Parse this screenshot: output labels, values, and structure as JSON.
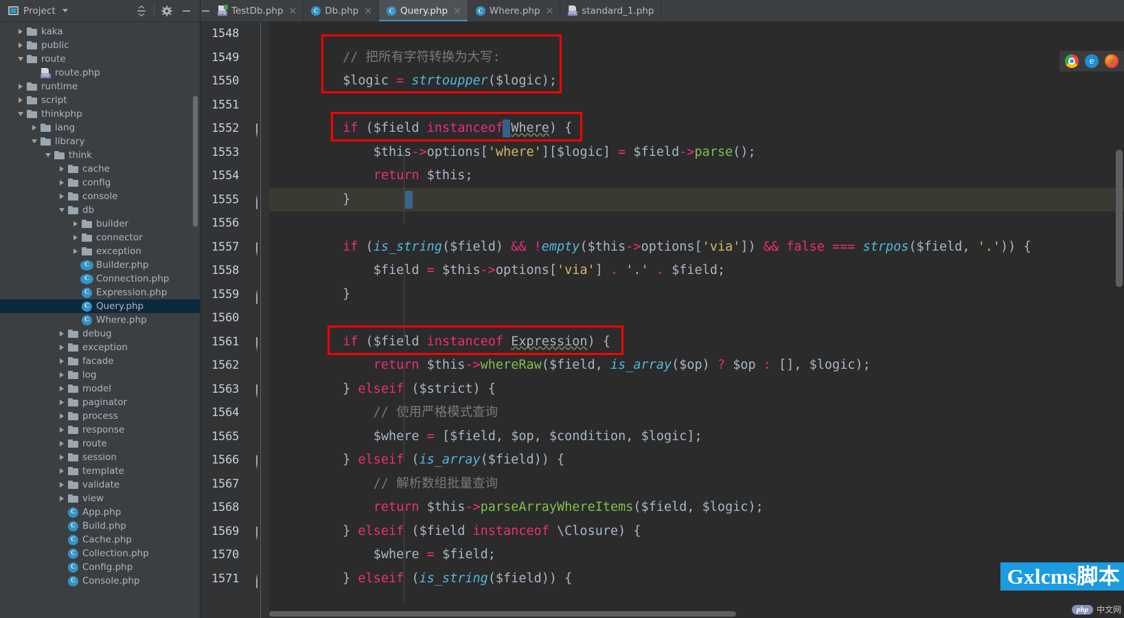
{
  "sidebar": {
    "title": "Project",
    "icons": [
      "project-icon",
      "collapse-all-icon",
      "gear-icon",
      "minimize-icon"
    ],
    "tree": [
      {
        "label": "kaka",
        "depth": 1,
        "type": "folder",
        "state": "collapsed"
      },
      {
        "label": "public",
        "depth": 1,
        "type": "folder",
        "state": "collapsed"
      },
      {
        "label": "route",
        "depth": 1,
        "type": "folder",
        "state": "expanded"
      },
      {
        "label": "route.php",
        "depth": 2,
        "type": "php",
        "state": "none"
      },
      {
        "label": "runtime",
        "depth": 1,
        "type": "folder",
        "state": "collapsed"
      },
      {
        "label": "script",
        "depth": 1,
        "type": "folder",
        "state": "collapsed"
      },
      {
        "label": "thinkphp",
        "depth": 1,
        "type": "folder",
        "state": "expanded"
      },
      {
        "label": "lang",
        "depth": 2,
        "type": "folder",
        "state": "collapsed"
      },
      {
        "label": "library",
        "depth": 2,
        "type": "folder",
        "state": "expanded"
      },
      {
        "label": "think",
        "depth": 3,
        "type": "folder",
        "state": "expanded"
      },
      {
        "label": "cache",
        "depth": 4,
        "type": "folder",
        "state": "collapsed"
      },
      {
        "label": "config",
        "depth": 4,
        "type": "folder",
        "state": "collapsed"
      },
      {
        "label": "console",
        "depth": 4,
        "type": "folder",
        "state": "collapsed"
      },
      {
        "label": "db",
        "depth": 4,
        "type": "folder",
        "state": "expanded"
      },
      {
        "label": "builder",
        "depth": 5,
        "type": "folder",
        "state": "collapsed"
      },
      {
        "label": "connector",
        "depth": 5,
        "type": "folder",
        "state": "collapsed"
      },
      {
        "label": "exception",
        "depth": 5,
        "type": "folder",
        "state": "collapsed"
      },
      {
        "label": "Builder.php",
        "depth": 5,
        "type": "class-abstract",
        "state": "none"
      },
      {
        "label": "Connection.php",
        "depth": 5,
        "type": "class-abstract",
        "state": "none"
      },
      {
        "label": "Expression.php",
        "depth": 5,
        "type": "class",
        "state": "none"
      },
      {
        "label": "Query.php",
        "depth": 5,
        "type": "class",
        "state": "none",
        "selected": true
      },
      {
        "label": "Where.php",
        "depth": 5,
        "type": "class",
        "state": "none"
      },
      {
        "label": "debug",
        "depth": 4,
        "type": "folder",
        "state": "collapsed"
      },
      {
        "label": "exception",
        "depth": 4,
        "type": "folder",
        "state": "collapsed"
      },
      {
        "label": "facade",
        "depth": 4,
        "type": "folder",
        "state": "collapsed"
      },
      {
        "label": "log",
        "depth": 4,
        "type": "folder",
        "state": "collapsed"
      },
      {
        "label": "model",
        "depth": 4,
        "type": "folder",
        "state": "collapsed"
      },
      {
        "label": "paginator",
        "depth": 4,
        "type": "folder",
        "state": "collapsed"
      },
      {
        "label": "process",
        "depth": 4,
        "type": "folder",
        "state": "collapsed"
      },
      {
        "label": "response",
        "depth": 4,
        "type": "folder",
        "state": "collapsed"
      },
      {
        "label": "route",
        "depth": 4,
        "type": "folder",
        "state": "collapsed"
      },
      {
        "label": "session",
        "depth": 4,
        "type": "folder",
        "state": "collapsed"
      },
      {
        "label": "template",
        "depth": 4,
        "type": "folder",
        "state": "collapsed"
      },
      {
        "label": "validate",
        "depth": 4,
        "type": "folder",
        "state": "collapsed"
      },
      {
        "label": "view",
        "depth": 4,
        "type": "folder",
        "state": "collapsed"
      },
      {
        "label": "App.php",
        "depth": 4,
        "type": "class",
        "state": "none"
      },
      {
        "label": "Build.php",
        "depth": 4,
        "type": "class",
        "state": "none"
      },
      {
        "label": "Cache.php",
        "depth": 4,
        "type": "class",
        "state": "none"
      },
      {
        "label": "Collection.php",
        "depth": 4,
        "type": "class",
        "state": "none"
      },
      {
        "label": "Config.php",
        "depth": 4,
        "type": "class",
        "state": "none"
      },
      {
        "label": "Console.php",
        "depth": 4,
        "type": "class",
        "state": "none"
      }
    ]
  },
  "tabs": [
    {
      "label": "TestDb.php",
      "icon": "php-file-icon",
      "active": false,
      "closable": true
    },
    {
      "label": "Db.php",
      "icon": "class-file-icon",
      "active": false,
      "closable": true
    },
    {
      "label": "Query.php",
      "icon": "class-file-icon",
      "active": true,
      "closable": true
    },
    {
      "label": "Where.php",
      "icon": "class-file-icon",
      "active": false,
      "closable": true
    },
    {
      "label": "standard_1.php",
      "icon": "php-file-icon",
      "active": false,
      "closable": false
    }
  ],
  "editor": {
    "caret_line": 1555,
    "lines": [
      {
        "num": 1548,
        "fold": "none",
        "text": ""
      },
      {
        "num": 1549,
        "fold": "none",
        "text": "        // 把所有字符转换为大写:"
      },
      {
        "num": 1550,
        "fold": "none",
        "text": "        $logic = strtoupper($logic);"
      },
      {
        "num": 1551,
        "fold": "none",
        "text": ""
      },
      {
        "num": 1552,
        "fold": "start",
        "text": "        if ($field instanceof Where) {"
      },
      {
        "num": 1553,
        "fold": "none",
        "text": "            $this->options['where'][$logic] = $field->parse();"
      },
      {
        "num": 1554,
        "fold": "none",
        "text": "            return $this;"
      },
      {
        "num": 1555,
        "fold": "end",
        "text": "        }"
      },
      {
        "num": 1556,
        "fold": "none",
        "text": ""
      },
      {
        "num": 1557,
        "fold": "start",
        "text": "        if (is_string($field) && !empty($this->options['via']) && false === strpos($field, '.')) {"
      },
      {
        "num": 1558,
        "fold": "none",
        "text": "            $field = $this->options['via'] . '.' . $field;"
      },
      {
        "num": 1559,
        "fold": "end",
        "text": "        }"
      },
      {
        "num": 1560,
        "fold": "none",
        "text": ""
      },
      {
        "num": 1561,
        "fold": "start",
        "text": "        if ($field instanceof Expression) {"
      },
      {
        "num": 1562,
        "fold": "none",
        "text": "            return $this->whereRaw($field, is_array($op) ? $op : [], $logic);"
      },
      {
        "num": 1563,
        "fold": "mid",
        "text": "        } elseif ($strict) {"
      },
      {
        "num": 1564,
        "fold": "none",
        "text": "            // 使用严格模式查询"
      },
      {
        "num": 1565,
        "fold": "none",
        "text": "            $where = [$field, $op, $condition, $logic];"
      },
      {
        "num": 1566,
        "fold": "mid",
        "text": "        } elseif (is_array($field)) {"
      },
      {
        "num": 1567,
        "fold": "none",
        "text": "            // 解析数组批量查询"
      },
      {
        "num": 1568,
        "fold": "none",
        "text": "            return $this->parseArrayWhereItems($field, $logic);"
      },
      {
        "num": 1569,
        "fold": "mid",
        "text": "        } elseif ($field instanceof \\Closure) {"
      },
      {
        "num": 1570,
        "fold": "none",
        "text": "            $where = $field;"
      },
      {
        "num": 1571,
        "fold": "end",
        "text": "        } elseif (is_string($field)) {"
      }
    ],
    "annotations": [
      {
        "name": "highlight-box-strtoupper",
        "target_lines": [
          1549,
          1550
        ],
        "color": "#ff0000"
      },
      {
        "name": "highlight-box-instanceof-where",
        "target_lines": [
          1552
        ],
        "color": "#ff0000"
      },
      {
        "name": "highlight-box-instanceof-expression",
        "target_lines": [
          1561
        ],
        "color": "#ff0000"
      }
    ]
  },
  "browser_bar": {
    "icons": [
      "chrome-icon",
      "edge-icon",
      "firefox-icon"
    ]
  },
  "watermarks": {
    "blue_text": "Gxlcms脚本",
    "php_badge": "php",
    "php_site": "中文网"
  },
  "colors": {
    "editor_bg": "#2b2b2b",
    "gutter_bg": "#313335",
    "sidebar_bg": "#3c3f41",
    "selection_blue": "#0d293e",
    "accent_blue": "#3592c4",
    "annotation_red": "#ff0000",
    "keyword_pink": "#ee2d7a",
    "function_cyan": "#51b9e0",
    "method_green": "#7fc24a",
    "string_yellow": "#d6bb6b",
    "comment_gray": "#7a7a7a",
    "watermark_blue": "#1b9be0"
  }
}
